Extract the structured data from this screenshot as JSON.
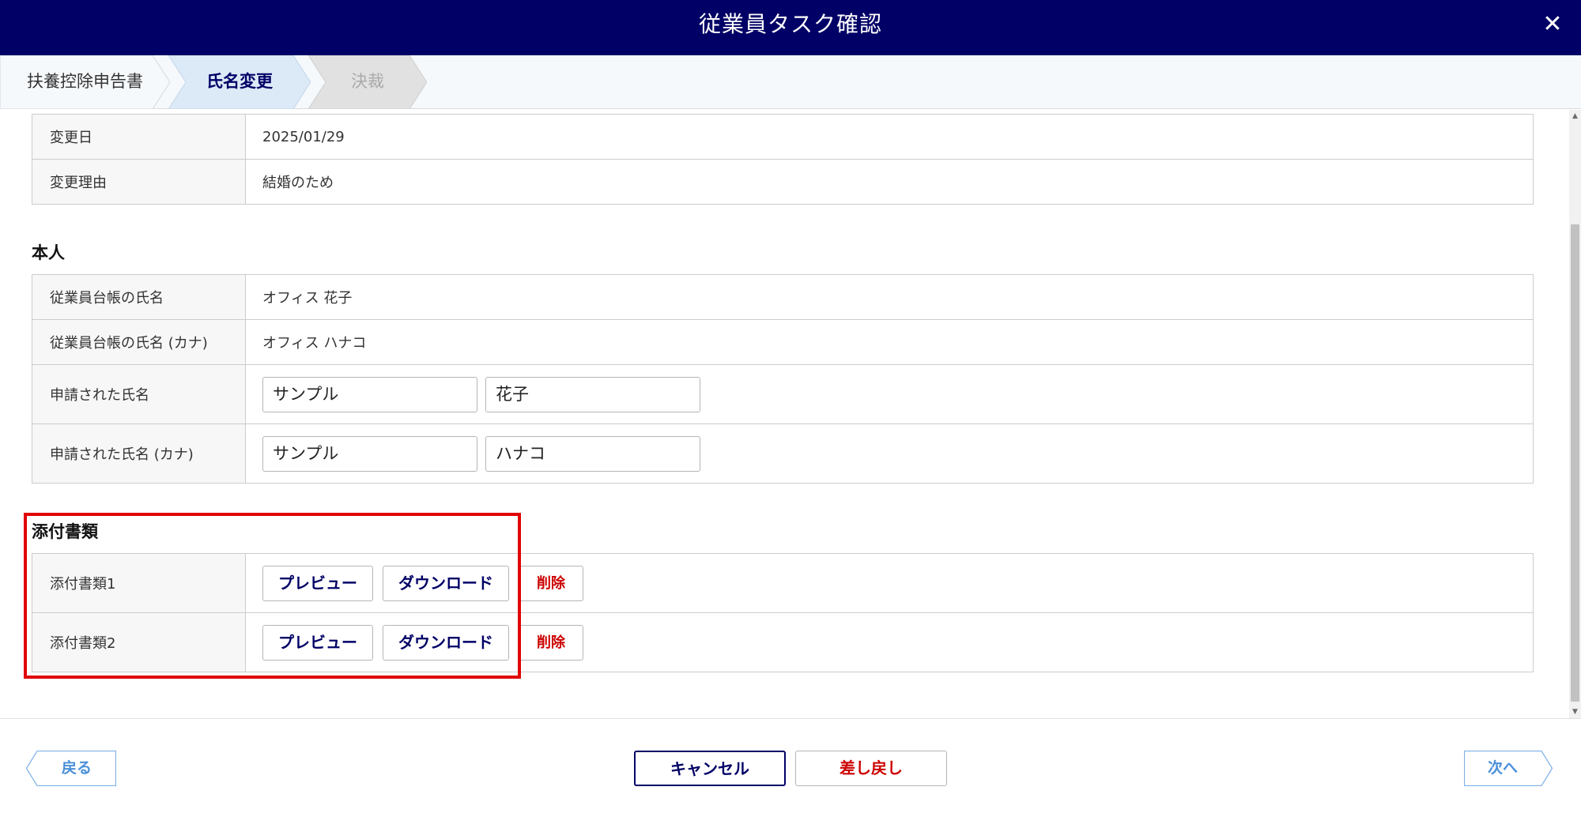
{
  "header": {
    "title": "従業員タスク確認",
    "close_label": "✕"
  },
  "steps": [
    {
      "label": "扶養控除申告書",
      "state": "done"
    },
    {
      "label": "氏名変更",
      "state": "active"
    },
    {
      "label": "決裁",
      "state": "upcoming"
    }
  ],
  "change_info": {
    "rows": [
      {
        "label": "変更日",
        "value": "2025/01/29"
      },
      {
        "label": "変更理由",
        "value": "結婚のため"
      }
    ]
  },
  "person": {
    "title": "本人",
    "registry_name_label": "従業員台帳の氏名",
    "registry_name_value": "オフィス 花子",
    "registry_kana_label": "従業員台帳の氏名 (カナ)",
    "registry_kana_value": "オフィス ハナコ",
    "requested_name_label": "申請された氏名",
    "requested_last_name": "サンプル",
    "requested_first_name": "花子",
    "requested_kana_label": "申請された氏名 (カナ)",
    "requested_last_kana": "サンプル",
    "requested_first_kana": "ハナコ"
  },
  "attachments": {
    "title": "添付書類",
    "items": [
      {
        "label": "添付書類1",
        "preview": "プレビュー",
        "download": "ダウンロード",
        "delete": "削除"
      },
      {
        "label": "添付書類2",
        "preview": "プレビュー",
        "download": "ダウンロード",
        "delete": "削除"
      }
    ]
  },
  "footer": {
    "back_label": "戻る",
    "cancel_label": "キャンセル",
    "return_label": "差し戻し",
    "next_label": "次へ"
  },
  "colors": {
    "header_bg": "#000066",
    "accent_navy": "#000066",
    "danger_red": "#cc0000",
    "nav_blue": "#4a90d9",
    "highlight": "#e00000"
  }
}
